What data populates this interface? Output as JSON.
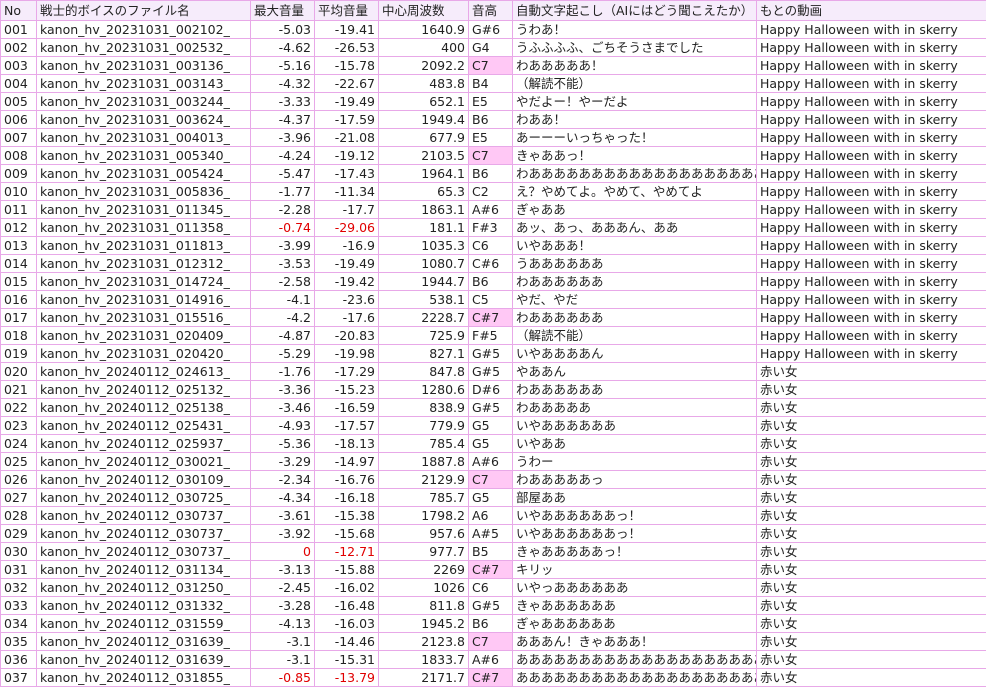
{
  "headers": [
    "No",
    "戦士的ボイスのファイル名",
    "最大音量",
    "平均音量",
    "中心周波数",
    "音高",
    "自動文字起こし（AIにはどう聞こえたか）",
    "もとの動画"
  ],
  "colors": {
    "border": "#e8a8e8",
    "header_bg": "#f6ecfb",
    "highlight": "#ffc8f5",
    "negative_red": "#e00000"
  },
  "rows": [
    {
      "no": "001",
      "file": "kanon_hv_20231031_002102_",
      "max": "-5.03",
      "avg": "-19.41",
      "freq": "1640.9",
      "pitch": "G#6",
      "text": "うわあ！",
      "src": "Happy Halloween with in skerry",
      "hl": false,
      "red": false
    },
    {
      "no": "002",
      "file": "kanon_hv_20231031_002532_",
      "max": "-4.62",
      "avg": "-26.53",
      "freq": "400",
      "pitch": "G4",
      "text": "うふふふふ、ごちそうさまでした",
      "src": "Happy Halloween with in skerry",
      "hl": false,
      "red": false
    },
    {
      "no": "003",
      "file": "kanon_hv_20231031_003136_",
      "max": "-5.16",
      "avg": "-15.78",
      "freq": "2092.2",
      "pitch": "C7",
      "text": "わあああああ！",
      "src": "Happy Halloween with in skerry",
      "hl": true,
      "red": false
    },
    {
      "no": "004",
      "file": "kanon_hv_20231031_003143_",
      "max": "-4.32",
      "avg": "-22.67",
      "freq": "483.8",
      "pitch": "B4",
      "text": "（解読不能）",
      "src": "Happy Halloween with in skerry",
      "hl": false,
      "red": false
    },
    {
      "no": "005",
      "file": "kanon_hv_20231031_003244_",
      "max": "-3.33",
      "avg": "-19.49",
      "freq": "652.1",
      "pitch": "E5",
      "text": "やだよー！やーだよ",
      "src": "Happy Halloween with in skerry",
      "hl": false,
      "red": false
    },
    {
      "no": "006",
      "file": "kanon_hv_20231031_003624_",
      "max": "-4.37",
      "avg": "-17.59",
      "freq": "1949.4",
      "pitch": "B6",
      "text": "わああ！",
      "src": "Happy Halloween with in skerry",
      "hl": false,
      "red": false
    },
    {
      "no": "007",
      "file": "kanon_hv_20231031_004013_",
      "max": "-3.96",
      "avg": "-21.08",
      "freq": "677.9",
      "pitch": "E5",
      "text": "あーーーいっちゃった！",
      "src": "Happy Halloween with in skerry",
      "hl": false,
      "red": false
    },
    {
      "no": "008",
      "file": "kanon_hv_20231031_005340_",
      "max": "-4.24",
      "avg": "-19.12",
      "freq": "2103.5",
      "pitch": "C7",
      "text": "きゃああっ！",
      "src": "Happy Halloween with in skerry",
      "hl": true,
      "red": false
    },
    {
      "no": "009",
      "file": "kanon_hv_20231031_005424_",
      "max": "-5.47",
      "avg": "-17.43",
      "freq": "1964.1",
      "pitch": "B6",
      "text": "わあああああああああああああああああああああ",
      "src": "Happy Halloween with in skerry",
      "hl": false,
      "red": false
    },
    {
      "no": "010",
      "file": "kanon_hv_20231031_005836_",
      "max": "-1.77",
      "avg": "-11.34",
      "freq": "65.3",
      "pitch": "C2",
      "text": "え？やめてよ。やめて、やめてよ",
      "src": "Happy Halloween with in skerry",
      "hl": false,
      "red": false
    },
    {
      "no": "011",
      "file": "kanon_hv_20231031_011345_",
      "max": "-2.28",
      "avg": "-17.7",
      "freq": "1863.1",
      "pitch": "A#6",
      "text": "ぎゃああ",
      "src": "Happy Halloween with in skerry",
      "hl": false,
      "red": false
    },
    {
      "no": "012",
      "file": "kanon_hv_20231031_011358_",
      "max": "-0.74",
      "avg": "-29.06",
      "freq": "181.1",
      "pitch": "F#3",
      "text": "あッ、あっ、あああん、ああ",
      "src": "Happy Halloween with in skerry",
      "hl": false,
      "red": true
    },
    {
      "no": "013",
      "file": "kanon_hv_20231031_011813_",
      "max": "-3.99",
      "avg": "-16.9",
      "freq": "1035.3",
      "pitch": "C6",
      "text": "いやあああ！",
      "src": "Happy Halloween with in skerry",
      "hl": false,
      "red": false
    },
    {
      "no": "014",
      "file": "kanon_hv_20231031_012312_",
      "max": "-3.53",
      "avg": "-19.49",
      "freq": "1080.7",
      "pitch": "C#6",
      "text": "うああああああ",
      "src": "Happy Halloween with in skerry",
      "hl": false,
      "red": false
    },
    {
      "no": "015",
      "file": "kanon_hv_20231031_014724_",
      "max": "-2.58",
      "avg": "-19.42",
      "freq": "1944.7",
      "pitch": "B6",
      "text": "わああああああ",
      "src": "Happy Halloween with in skerry",
      "hl": false,
      "red": false
    },
    {
      "no": "016",
      "file": "kanon_hv_20231031_014916_",
      "max": "-4.1",
      "avg": "-23.6",
      "freq": "538.1",
      "pitch": "C5",
      "text": "やだ、やだ",
      "src": "Happy Halloween with in skerry",
      "hl": false,
      "red": false
    },
    {
      "no": "017",
      "file": "kanon_hv_20231031_015516_",
      "max": "-4.2",
      "avg": "-17.6",
      "freq": "2228.7",
      "pitch": "C#7",
      "text": "わああああああ",
      "src": "Happy Halloween with in skerry",
      "hl": true,
      "red": false
    },
    {
      "no": "018",
      "file": "kanon_hv_20231031_020409_",
      "max": "-4.87",
      "avg": "-20.83",
      "freq": "725.9",
      "pitch": "F#5",
      "text": "（解読不能）",
      "src": "Happy Halloween with in skerry",
      "hl": false,
      "red": false
    },
    {
      "no": "019",
      "file": "kanon_hv_20231031_020420_",
      "max": "-5.29",
      "avg": "-19.98",
      "freq": "827.1",
      "pitch": "G#5",
      "text": "いやああああん",
      "src": "Happy Halloween with in skerry",
      "hl": false,
      "red": false
    },
    {
      "no": "020",
      "file": "kanon_hv_20240112_024613_",
      "max": "-1.76",
      "avg": "-17.29",
      "freq": "847.8",
      "pitch": "G#5",
      "text": "やああん",
      "src": "赤い女",
      "hl": false,
      "red": false
    },
    {
      "no": "021",
      "file": "kanon_hv_20240112_025132_",
      "max": "-3.36",
      "avg": "-15.23",
      "freq": "1280.6",
      "pitch": "D#6",
      "text": "わああああああ",
      "src": "赤い女",
      "hl": false,
      "red": false
    },
    {
      "no": "022",
      "file": "kanon_hv_20240112_025138_",
      "max": "-3.46",
      "avg": "-16.59",
      "freq": "838.9",
      "pitch": "G#5",
      "text": "わあああああ",
      "src": "赤い女",
      "hl": false,
      "red": false
    },
    {
      "no": "023",
      "file": "kanon_hv_20240112_025431_",
      "max": "-4.93",
      "avg": "-17.57",
      "freq": "779.9",
      "pitch": "G5",
      "text": "いやああああああ",
      "src": "赤い女",
      "hl": false,
      "red": false
    },
    {
      "no": "024",
      "file": "kanon_hv_20240112_025937_",
      "max": "-5.36",
      "avg": "-18.13",
      "freq": "785.4",
      "pitch": "G5",
      "text": "いやああ",
      "src": "赤い女",
      "hl": false,
      "red": false
    },
    {
      "no": "025",
      "file": "kanon_hv_20240112_030021_",
      "max": "-3.29",
      "avg": "-14.97",
      "freq": "1887.8",
      "pitch": "A#6",
      "text": "うわー",
      "src": "赤い女",
      "hl": false,
      "red": false
    },
    {
      "no": "026",
      "file": "kanon_hv_20240112_030109_",
      "max": "-2.34",
      "avg": "-16.76",
      "freq": "2129.9",
      "pitch": "C7",
      "text": "わあああああっ",
      "src": "赤い女",
      "hl": true,
      "red": false
    },
    {
      "no": "027",
      "file": "kanon_hv_20240112_030725_",
      "max": "-4.34",
      "avg": "-16.18",
      "freq": "785.7",
      "pitch": "G5",
      "text": "部屋ああ",
      "src": "赤い女",
      "hl": false,
      "red": false
    },
    {
      "no": "028",
      "file": "kanon_hv_20240112_030737_",
      "max": "-3.61",
      "avg": "-15.38",
      "freq": "1798.2",
      "pitch": "A6",
      "text": "いやああああああっ！",
      "src": "赤い女",
      "hl": false,
      "red": false
    },
    {
      "no": "029",
      "file": "kanon_hv_20240112_030737_",
      "max": "-3.92",
      "avg": "-15.68",
      "freq": "957.6",
      "pitch": "A#5",
      "text": "いやああああああっ！",
      "src": "赤い女",
      "hl": false,
      "red": false
    },
    {
      "no": "030",
      "file": "kanon_hv_20240112_030737_",
      "max": "0",
      "avg": "-12.71",
      "freq": "977.7",
      "pitch": "B5",
      "text": "きゃあああああっ！",
      "src": "赤い女",
      "hl": false,
      "red": true
    },
    {
      "no": "031",
      "file": "kanon_hv_20240112_031134_",
      "max": "-3.13",
      "avg": "-15.88",
      "freq": "2269",
      "pitch": "C#7",
      "text": "キリッ",
      "src": "赤い女",
      "hl": true,
      "red": false
    },
    {
      "no": "032",
      "file": "kanon_hv_20240112_031250_",
      "max": "-2.45",
      "avg": "-16.02",
      "freq": "1026",
      "pitch": "C6",
      "text": "いやっああああああ",
      "src": "赤い女",
      "hl": false,
      "red": false
    },
    {
      "no": "033",
      "file": "kanon_hv_20240112_031332_",
      "max": "-3.28",
      "avg": "-16.48",
      "freq": "811.8",
      "pitch": "G#5",
      "text": "きゃああああああ",
      "src": "赤い女",
      "hl": false,
      "red": false
    },
    {
      "no": "034",
      "file": "kanon_hv_20240112_031559_",
      "max": "-4.13",
      "avg": "-16.03",
      "freq": "1945.2",
      "pitch": "B6",
      "text": "ぎゃああああああ",
      "src": "赤い女",
      "hl": false,
      "red": false
    },
    {
      "no": "035",
      "file": "kanon_hv_20240112_031639_",
      "max": "-3.1",
      "avg": "-14.46",
      "freq": "2123.8",
      "pitch": "C7",
      "text": "あああん！きゃあああ！",
      "src": "赤い女",
      "hl": true,
      "red": false
    },
    {
      "no": "036",
      "file": "kanon_hv_20240112_031639_",
      "max": "-3.1",
      "avg": "-15.31",
      "freq": "1833.7",
      "pitch": "A#6",
      "text": "あああああああああああああああああああああ",
      "src": "赤い女",
      "hl": false,
      "red": false
    },
    {
      "no": "037",
      "file": "kanon_hv_20240112_031855_",
      "max": "-0.85",
      "avg": "-13.79",
      "freq": "2171.7",
      "pitch": "C#7",
      "text": "あああああああああああああああああああああ",
      "src": "赤い女",
      "hl": true,
      "red": true
    }
  ]
}
